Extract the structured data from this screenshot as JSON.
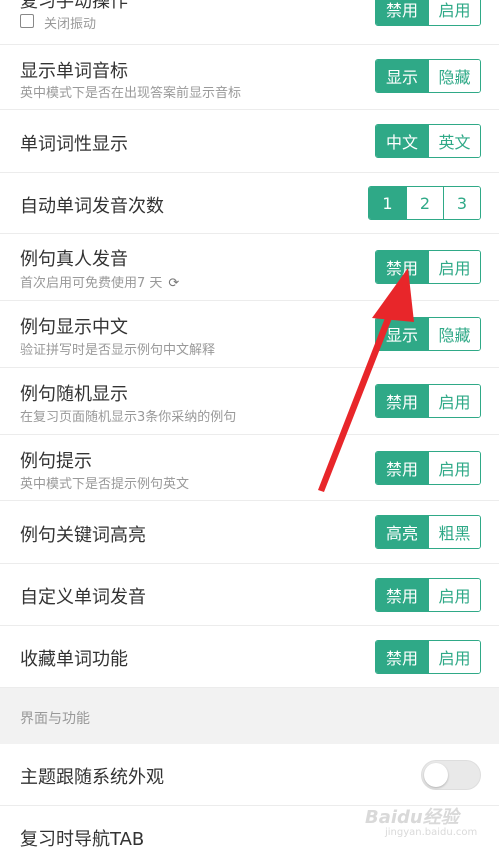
{
  "rows": [
    {
      "title": "复习手动操作",
      "sub": "关闭振动",
      "options": [
        "禁用",
        "启用"
      ],
      "selected": 0
    },
    {
      "title": "显示单词音标",
      "sub": "英中模式下是否在出现答案前显示音标",
      "options": [
        "显示",
        "隐藏"
      ],
      "selected": 0
    },
    {
      "title": "单词词性显示",
      "sub": "",
      "options": [
        "中文",
        "英文"
      ],
      "selected": 0
    },
    {
      "title": "自动单词发音次数",
      "sub": "",
      "options": [
        "1",
        "2",
        "3"
      ],
      "selected": 0
    },
    {
      "title": "例句真人发音",
      "sub": "首次启用可免费使用7 天",
      "options": [
        "禁用",
        "启用"
      ],
      "selected": 0
    },
    {
      "title": "例句显示中文",
      "sub": "验证拼写时是否显示例句中文解释",
      "options": [
        "显示",
        "隐藏"
      ],
      "selected": 0
    },
    {
      "title": "例句随机显示",
      "sub": "在复习页面随机显示3条你采纳的例句",
      "options": [
        "禁用",
        "启用"
      ],
      "selected": 0
    },
    {
      "title": "例句提示",
      "sub": "英中模式下是否提示例句英文",
      "options": [
        "禁用",
        "启用"
      ],
      "selected": 0
    },
    {
      "title": "例句关键词高亮",
      "sub": "",
      "options": [
        "高亮",
        "粗黑"
      ],
      "selected": 0
    },
    {
      "title": "自定义单词发音",
      "sub": "",
      "options": [
        "禁用",
        "启用"
      ],
      "selected": 0
    },
    {
      "title": "收藏单词功能",
      "sub": "",
      "options": [
        "禁用",
        "启用"
      ],
      "selected": 0
    }
  ],
  "section": {
    "title": "界面与功能"
  },
  "theme_row": {
    "title": "主题跟随系统外观",
    "toggle_on": false
  },
  "nav_row": {
    "title": "复习时导航TAB"
  },
  "watermark": {
    "text": "Baidu经验",
    "url": "jingyan.baidu.com"
  },
  "colors": {
    "accent": "#2fa987",
    "arrow": "#e8262a"
  }
}
